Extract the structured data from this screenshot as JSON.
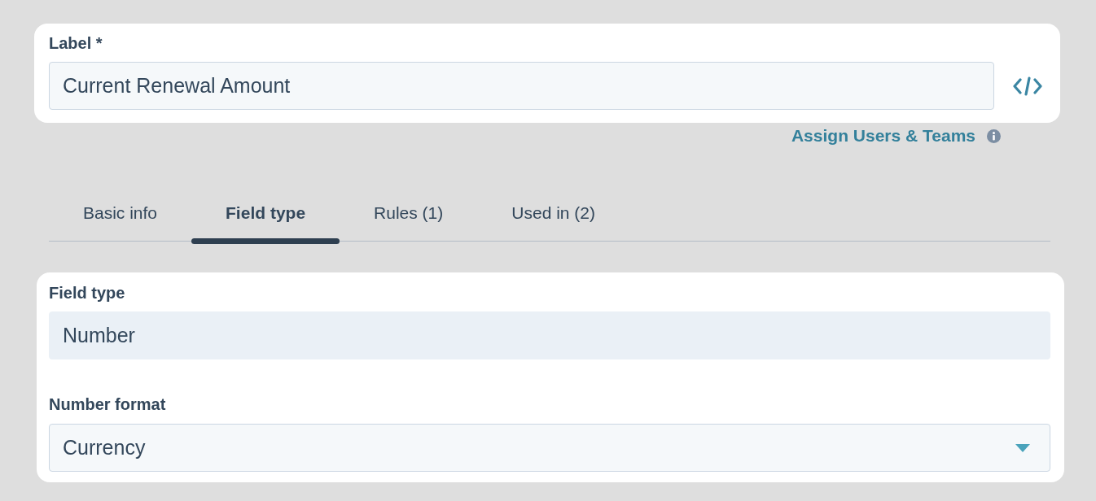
{
  "label_field": {
    "label": "Label *",
    "value": "Current Renewal Amount"
  },
  "assign_link": {
    "label": "Assign Users & Teams"
  },
  "tabs": [
    {
      "label": "Basic info",
      "selected": false
    },
    {
      "label": "Field type",
      "selected": true
    },
    {
      "label": "Rules (1)",
      "selected": false
    },
    {
      "label": "Used in (2)",
      "selected": false
    }
  ],
  "field_type": {
    "label": "Field type",
    "value": "Number",
    "disabled": true
  },
  "number_format": {
    "label": "Number format",
    "value": "Currency"
  }
}
